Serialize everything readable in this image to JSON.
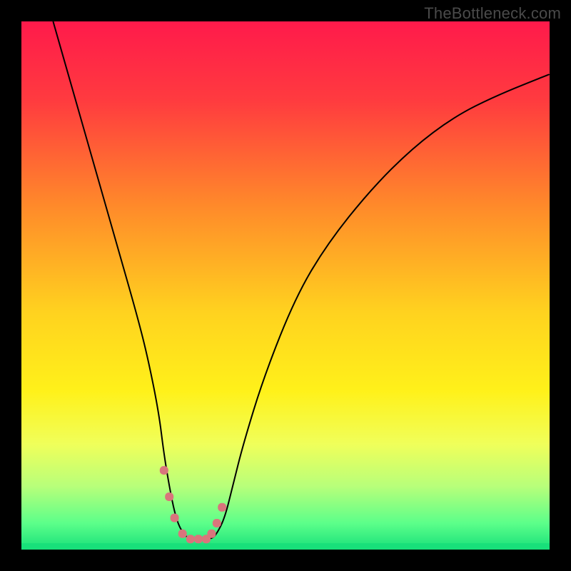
{
  "attribution": "TheBottleneck.com",
  "chart_data": {
    "type": "line",
    "title": "",
    "xlabel": "",
    "ylabel": "",
    "xlim": [
      0,
      100
    ],
    "ylim": [
      0,
      100
    ],
    "background_gradient": {
      "stops": [
        {
          "offset": 0.0,
          "color": "#ff1a4b"
        },
        {
          "offset": 0.15,
          "color": "#ff3b3f"
        },
        {
          "offset": 0.35,
          "color": "#ff8a2a"
        },
        {
          "offset": 0.55,
          "color": "#ffd21f"
        },
        {
          "offset": 0.7,
          "color": "#fff11a"
        },
        {
          "offset": 0.8,
          "color": "#f0ff5a"
        },
        {
          "offset": 0.88,
          "color": "#b8ff7a"
        },
        {
          "offset": 0.95,
          "color": "#5cff8a"
        },
        {
          "offset": 1.0,
          "color": "#18e07a"
        }
      ]
    },
    "curve": {
      "x": [
        6,
        10,
        14,
        18,
        22,
        24,
        26,
        27,
        28,
        29,
        30,
        31.5,
        34,
        36,
        37,
        38.5,
        40,
        42,
        46,
        52,
        58,
        66,
        74,
        82,
        90,
        100
      ],
      "y_percent": [
        100,
        86,
        72,
        58,
        44,
        36,
        26,
        18,
        12,
        7,
        4,
        2,
        2,
        2,
        3,
        6,
        12,
        20,
        33,
        48,
        58,
        68,
        76,
        82,
        86,
        90
      ]
    },
    "highlight_points": {
      "x": [
        27.0,
        28.0,
        29.0,
        30.5,
        32.0,
        33.5,
        35.0,
        36.0,
        37.0,
        38.0
      ],
      "y_percent": [
        15.0,
        10.0,
        6.0,
        3.0,
        2.0,
        2.0,
        2.0,
        3.0,
        5.0,
        8.0
      ],
      "color": "#d9757c",
      "size": 12
    },
    "green_floor": {
      "y_percent": 1.2,
      "color": "#18e07a"
    }
  }
}
